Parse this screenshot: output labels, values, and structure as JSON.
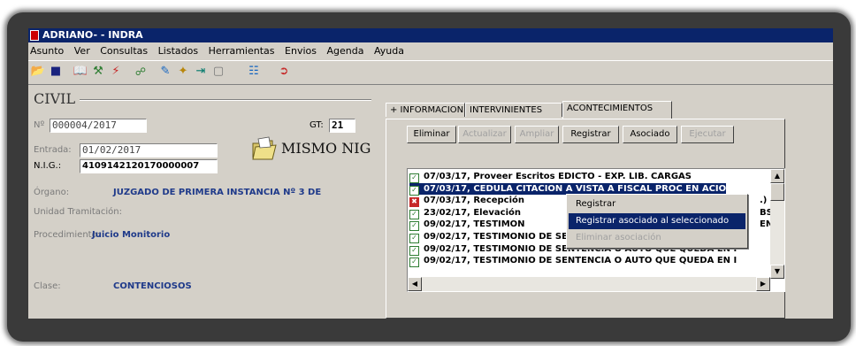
{
  "window": {
    "title": "ADRIANO- - INDRA"
  },
  "menubar": [
    "Asunto",
    "Ver",
    "Consultas",
    "Listados",
    "Herramientas",
    "Envios",
    "Agenda",
    "Ayuda"
  ],
  "toolbar": {
    "icons": [
      "open-folder-icon",
      "save-icon",
      "book-icon",
      "tools-icon",
      "lightning-icon",
      "network-icon",
      "edit-icon",
      "wand-icon",
      "export-icon",
      "blank-icon",
      "search-docs-icon",
      "exit-icon"
    ]
  },
  "left": {
    "section_title": "CIVIL",
    "num_label": "Nº",
    "num_value": "000004/2017",
    "gt_label": "GT:",
    "gt_value": "21",
    "entrada_label": "Entrada:",
    "entrada_value": "01/02/2017",
    "nig_label": "N.I.G.:",
    "nig_value": "4109142120170000007",
    "mismo_nig": "MISMO NIG",
    "organo_label": "Órgano:",
    "organo_value": "JUZGADO DE PRIMERA INSTANCIA Nº 3 DE",
    "unidad_label": "Unidad Tramitación:",
    "procedimiento_label": "Procedimiento:",
    "procedimiento_value": "Juicio Monitorio",
    "clase_label": "Clase:",
    "clase_value": "CONTENCIOSOS"
  },
  "tabs": [
    "+ INFORMACION",
    "INTERVINIENTES",
    "ACONTECIMIENTOS"
  ],
  "buttons": {
    "eliminar": "Eliminar",
    "actualizar": "Actualizar",
    "ampliar": "Ampliar",
    "registrar": "Registrar",
    "asociado": "Asociado",
    "ejecutar": "Ejecutar"
  },
  "events": [
    {
      "text": "07/03/17, Proveer Escritos EDICTO - EXP. LIB. CARGAS",
      "state": "check",
      "selected": false
    },
    {
      "text": "07/03/17, CEDULA CITACION A VISTA A FISCAL PROC EN ACIO",
      "state": "check",
      "selected": true
    },
    {
      "text": "07/03/17, Recepción",
      "suffix": ".) za",
      "state": "red",
      "selected": false
    },
    {
      "text": "23/02/17, Elevación",
      "suffix": "BSO",
      "state": "check",
      "selected": false
    },
    {
      "text": "09/02/17,  TESTIMON",
      "suffix": "EN I",
      "state": "check",
      "selected": false
    },
    {
      "text": "09/02/17,  TESTIMONIO DE SENTENCIA O AUTO QUE QUEDA EN I",
      "state": "check",
      "selected": false
    },
    {
      "text": "09/02/17,  TESTIMONIO DE SENTENCIA O AUTO QUE QUEDA EN I",
      "state": "check",
      "selected": false
    },
    {
      "text": "09/02/17,  TESTIMONIO DE SENTENCIA O AUTO QUE QUEDA EN I",
      "state": "check",
      "selected": false
    }
  ],
  "context_menu": {
    "registrar": "Registrar",
    "registrar_asociado": "Registrar asociado al seleccionado",
    "eliminar_asociacion": "Eliminar asociación"
  }
}
